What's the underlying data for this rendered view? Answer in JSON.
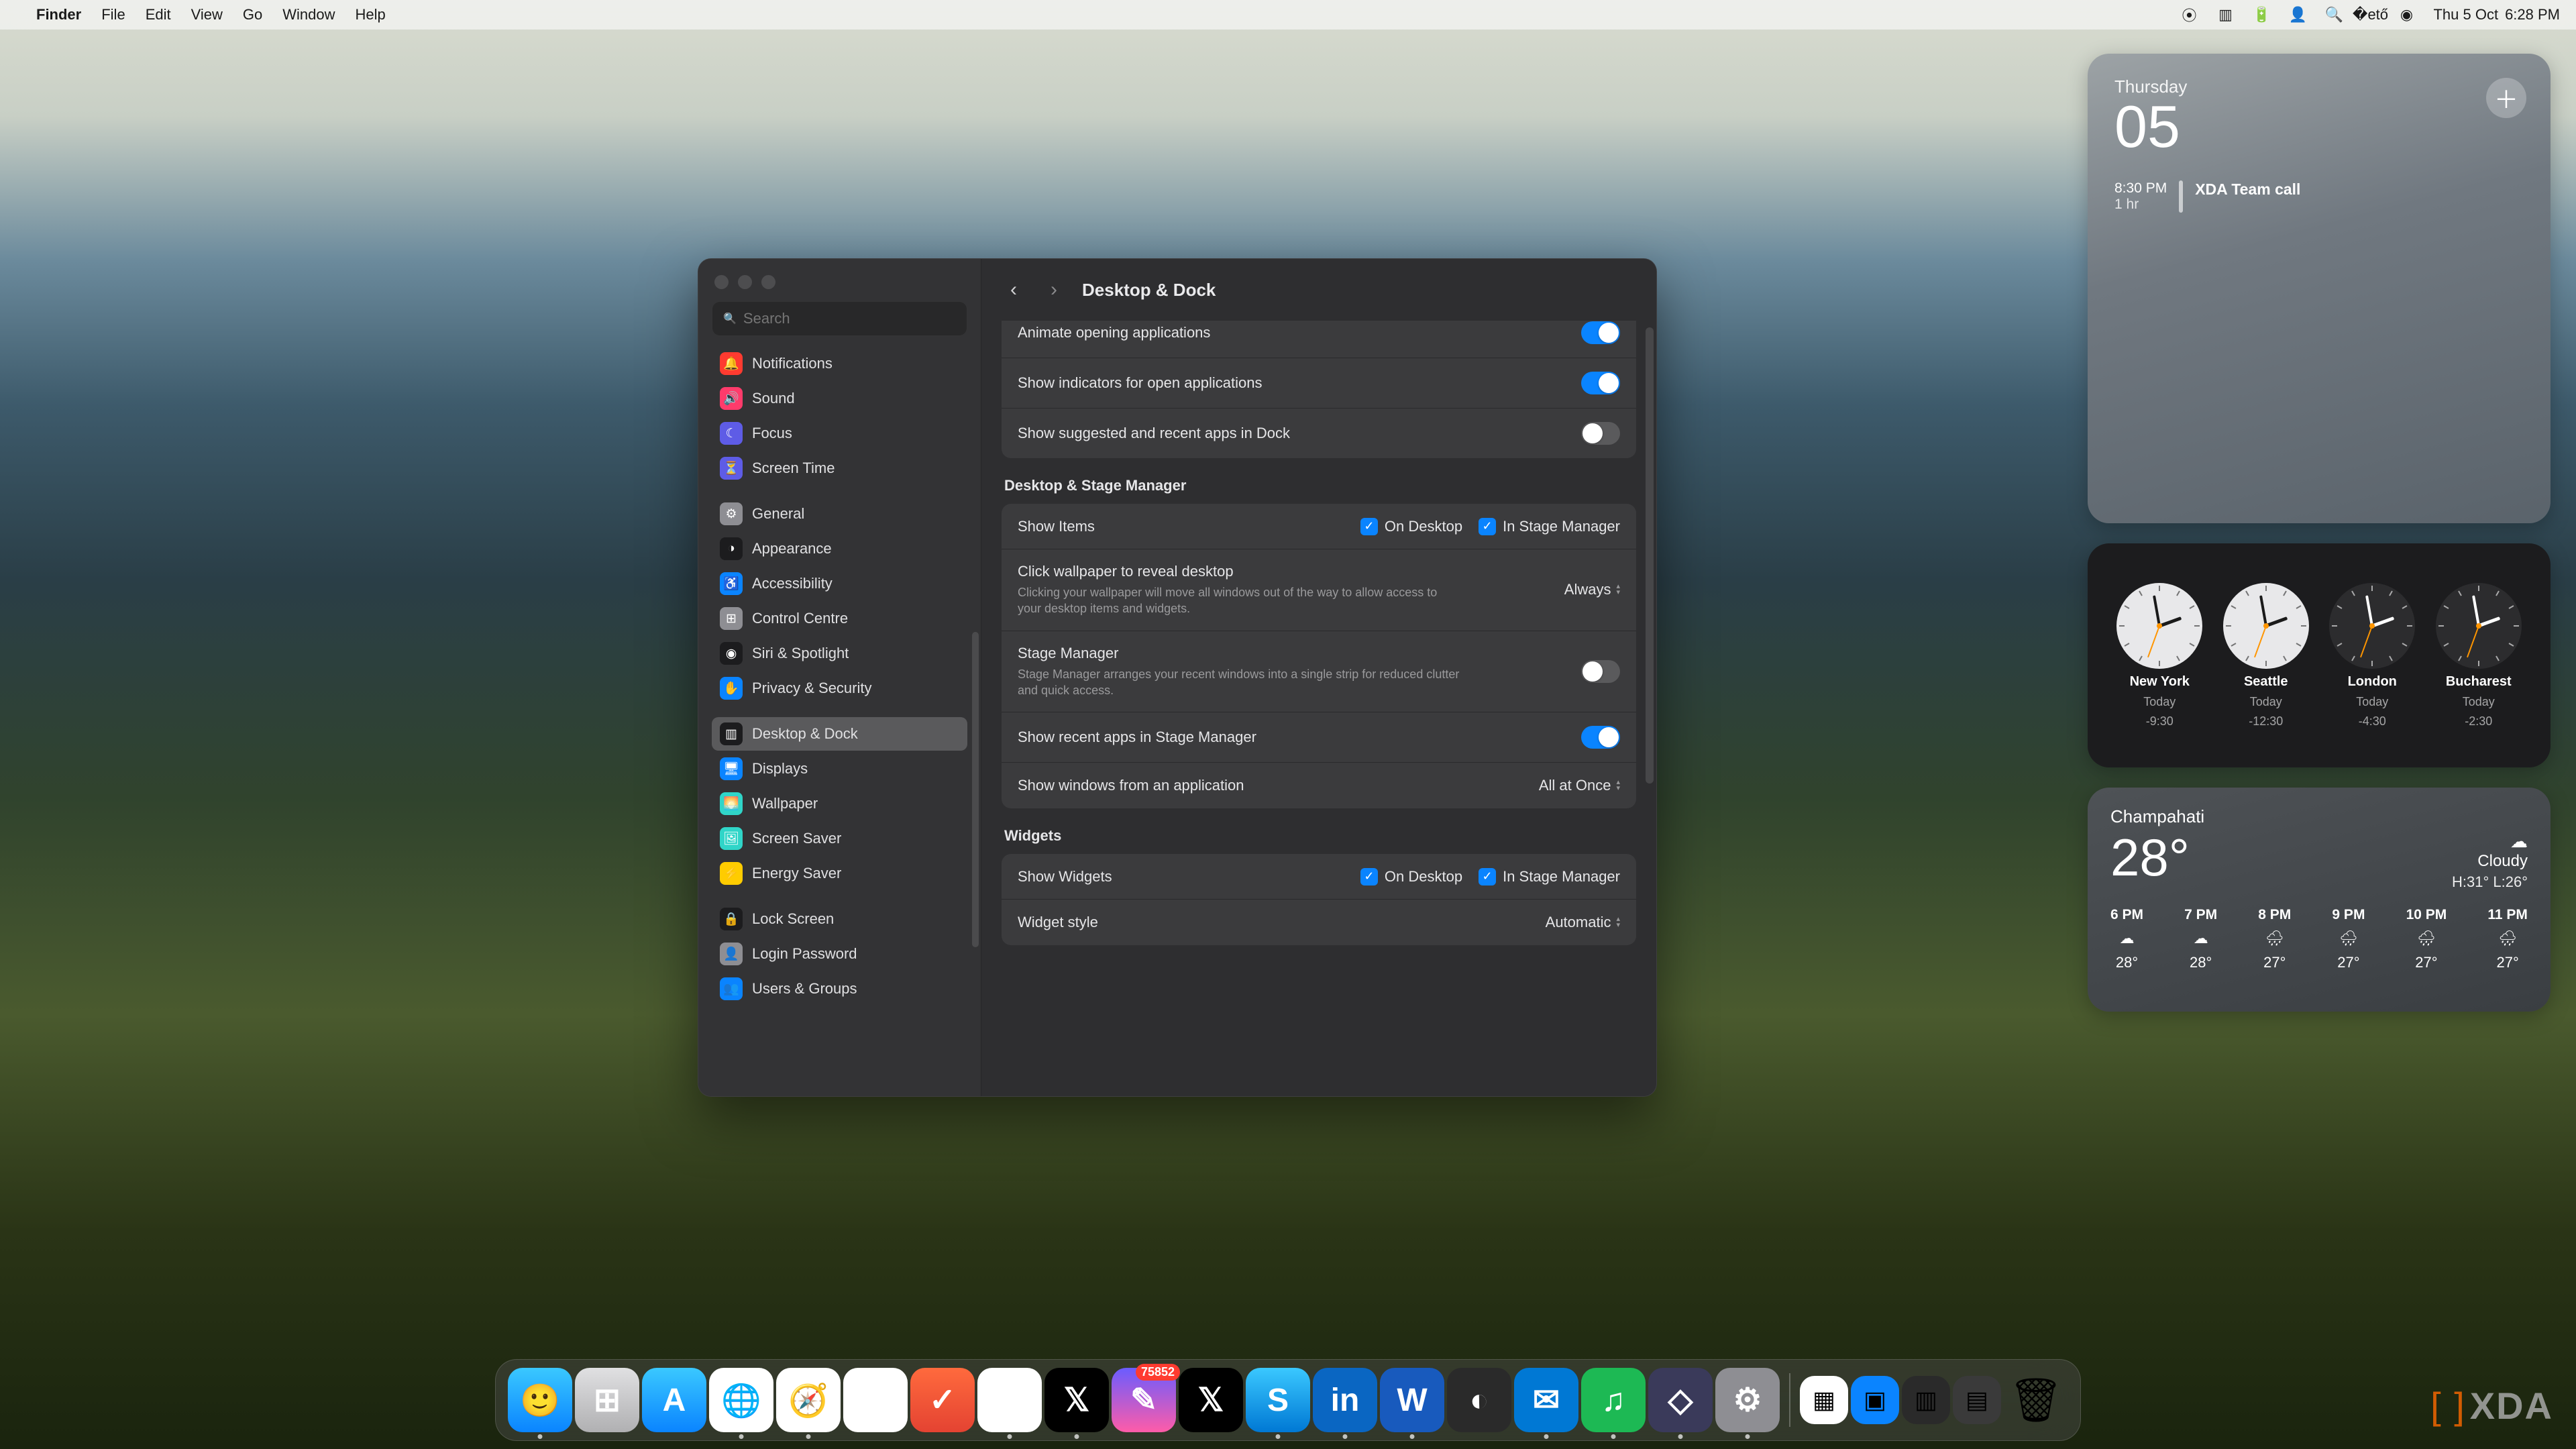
{
  "menubar": {
    "app": "Finder",
    "items": [
      "File",
      "Edit",
      "View",
      "Go",
      "Window",
      "Help"
    ],
    "date": "Thu 5 Oct",
    "time": "6:28 PM"
  },
  "settings": {
    "title": "Desktop & Dock",
    "search_placeholder": "Search",
    "sidebar": [
      {
        "label": "Notifications",
        "icon": "🔔",
        "color": "#ff3b30"
      },
      {
        "label": "Sound",
        "icon": "🔊",
        "color": "#ff3b6b"
      },
      {
        "label": "Focus",
        "icon": "☾",
        "color": "#5e5ce6"
      },
      {
        "label": "Screen Time",
        "icon": "⏳",
        "color": "#5e5ce6",
        "sep": true
      },
      {
        "label": "General",
        "icon": "⚙",
        "color": "#8e8e93"
      },
      {
        "label": "Appearance",
        "icon": "◑",
        "color": "#1c1c1e"
      },
      {
        "label": "Accessibility",
        "icon": "♿",
        "color": "#0a84ff"
      },
      {
        "label": "Control Centre",
        "icon": "⊞",
        "color": "#8e8e93"
      },
      {
        "label": "Siri & Spotlight",
        "icon": "◉",
        "color": "#1c1c1e"
      },
      {
        "label": "Privacy & Security",
        "icon": "✋",
        "color": "#0a84ff",
        "sep": true
      },
      {
        "label": "Desktop & Dock",
        "icon": "▥",
        "color": "#1c1c1e",
        "selected": true
      },
      {
        "label": "Displays",
        "icon": "🖥",
        "color": "#0a84ff"
      },
      {
        "label": "Wallpaper",
        "icon": "🌅",
        "color": "#30d5c8"
      },
      {
        "label": "Screen Saver",
        "icon": "🖼",
        "color": "#30d5c8"
      },
      {
        "label": "Energy Saver",
        "icon": "⚡",
        "color": "#ffcc00",
        "sep": true
      },
      {
        "label": "Lock Screen",
        "icon": "🔒",
        "color": "#1c1c1e"
      },
      {
        "label": "Login Password",
        "icon": "👤",
        "color": "#8e8e93"
      },
      {
        "label": "Users & Groups",
        "icon": "👥",
        "color": "#0a84ff"
      }
    ],
    "rows": {
      "animate": "Animate opening applications",
      "indicators": "Show indicators for open applications",
      "suggested": "Show suggested and recent apps in Dock",
      "section_dsm": "Desktop & Stage Manager",
      "show_items": "Show Items",
      "on_desktop": "On Desktop",
      "in_sm": "In Stage Manager",
      "click_wall": "Click wallpaper to reveal desktop",
      "click_wall_desc": "Clicking your wallpaper will move all windows out of the way to allow access to your desktop items and widgets.",
      "click_wall_val": "Always",
      "sm": "Stage Manager",
      "sm_desc": "Stage Manager arranges your recent windows into a single strip for reduced clutter and quick access.",
      "show_recent_sm": "Show recent apps in Stage Manager",
      "show_windows": "Show windows from an application",
      "show_windows_val": "All at Once",
      "section_widgets": "Widgets",
      "show_widgets": "Show Widgets",
      "widget_style": "Widget style",
      "widget_style_val": "Automatic"
    }
  },
  "calendar": {
    "day": "Thursday",
    "date": "05",
    "event_time": "8:30 PM",
    "event_dur": "1 hr",
    "event_title": "XDA Team call"
  },
  "clocks": [
    {
      "city": "New York",
      "today": "Today",
      "offset": "-9:30",
      "light": true
    },
    {
      "city": "Seattle",
      "today": "Today",
      "offset": "-12:30",
      "light": true
    },
    {
      "city": "London",
      "today": "Today",
      "offset": "-4:30",
      "light": false
    },
    {
      "city": "Bucharest",
      "today": "Today",
      "offset": "-2:30",
      "light": false
    }
  ],
  "weather": {
    "city": "Champahati",
    "temp": "28°",
    "cond": "Cloudy",
    "hl": "H:31° L:26°",
    "hours": [
      {
        "t": "6 PM",
        "icon": "☁",
        "temp": "28°"
      },
      {
        "t": "7 PM",
        "icon": "☁",
        "temp": "28°"
      },
      {
        "t": "8 PM",
        "icon": "🌧",
        "temp": "27°"
      },
      {
        "t": "9 PM",
        "icon": "🌧",
        "temp": "27°"
      },
      {
        "t": "10 PM",
        "icon": "🌧",
        "temp": "27°"
      },
      {
        "t": "11 PM",
        "icon": "🌧",
        "temp": "27°"
      }
    ]
  },
  "dock": {
    "badge": "75852",
    "apps": [
      {
        "name": "finder",
        "bg": "linear-gradient(#3ac8ff,#0a84ff)",
        "glyph": "🙂",
        "running": true
      },
      {
        "name": "launchpad",
        "bg": "linear-gradient(#e0e0e2,#b0b0b2)",
        "glyph": "⊞"
      },
      {
        "name": "appstore",
        "bg": "linear-gradient(#3ac8ff,#0a84ff)",
        "glyph": "A"
      },
      {
        "name": "edge",
        "bg": "#fff",
        "glyph": "🌐",
        "running": true
      },
      {
        "name": "safari",
        "bg": "#fff",
        "glyph": "🧭",
        "running": true
      },
      {
        "name": "craft",
        "bg": "#fff",
        "glyph": "◆"
      },
      {
        "name": "todoist",
        "bg": "linear-gradient(#ff6a3d,#e44332)",
        "glyph": "✓"
      },
      {
        "name": "slack",
        "bg": "#fff",
        "glyph": "⧉",
        "running": true
      },
      {
        "name": "x",
        "bg": "#000",
        "glyph": "𝕏",
        "running": true
      },
      {
        "name": "tweetdeck",
        "bg": "linear-gradient(#6a5cff,#ff5ca8)",
        "glyph": "✎",
        "badge": true
      },
      {
        "name": "x2",
        "bg": "#000",
        "glyph": "𝕏"
      },
      {
        "name": "skype",
        "bg": "linear-gradient(#3ac8ff,#0078d4)",
        "glyph": "S",
        "running": true
      },
      {
        "name": "linkedin",
        "bg": "#0a66c2",
        "glyph": "in",
        "running": true
      },
      {
        "name": "word",
        "bg": "#185abd",
        "glyph": "W",
        "running": true
      },
      {
        "name": "app1",
        "bg": "#2a2a2a",
        "glyph": "◐"
      },
      {
        "name": "outlook",
        "bg": "#0078d4",
        "glyph": "✉",
        "running": true
      },
      {
        "name": "spotify",
        "bg": "#1db954",
        "glyph": "♫",
        "running": true
      },
      {
        "name": "obsidian",
        "bg": "#3a3a5a",
        "glyph": "◇",
        "running": true
      },
      {
        "name": "settings",
        "bg": "#8e8e93",
        "glyph": "⚙",
        "running": true
      }
    ],
    "recents": [
      {
        "name": "r1",
        "bg": "#fff",
        "glyph": "▦"
      },
      {
        "name": "r2",
        "bg": "#0a84ff",
        "glyph": "▣"
      },
      {
        "name": "r3",
        "bg": "#2a2a2a",
        "glyph": "▥"
      },
      {
        "name": "r4",
        "bg": "#3a3a3a",
        "glyph": "▤"
      }
    ]
  },
  "xda": "XDA"
}
